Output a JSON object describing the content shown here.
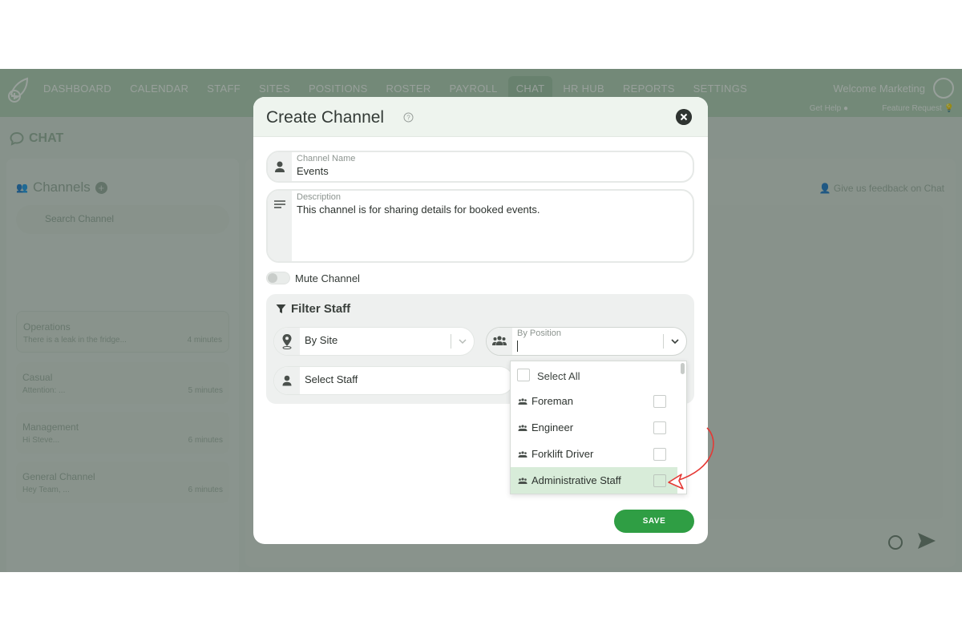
{
  "nav": {
    "items": [
      "DASHBOARD",
      "CALENDAR",
      "STAFF",
      "SITES",
      "POSITIONS",
      "ROSTER",
      "PAYROLL",
      "CHAT",
      "HR HUB",
      "REPORTS",
      "SETTINGS"
    ],
    "active": "CHAT",
    "welcome": "Welcome Marketing",
    "get_help": "Get Help",
    "feature_request": "Feature Request"
  },
  "page": {
    "title": "CHAT"
  },
  "sidebar": {
    "title": "Channels",
    "search_placeholder": "Search Channel",
    "channels": [
      {
        "name": "Operations",
        "message": "There is a leak in the fridge...",
        "time": "4 minutes"
      },
      {
        "name": "Casual",
        "message": "Attention: ...",
        "time": "5 minutes"
      },
      {
        "name": "Management",
        "message": "Hi Steve...",
        "time": "6 minutes"
      },
      {
        "name": "General Channel",
        "message": "Hey Team, ...",
        "time": "6 minutes"
      }
    ]
  },
  "main": {
    "feedback": "Give us feedback on Chat"
  },
  "modal": {
    "title": "Create Channel",
    "channel_name_label": "Channel Name",
    "channel_name_value": "Events",
    "description_label": "Description",
    "description_value": "This channel is for sharing details for booked events.",
    "mute_label": "Mute Channel",
    "filter_title": "Filter Staff",
    "by_site": "By Site",
    "by_position_label": "By Position",
    "select_staff": "Select Staff",
    "save": "SAVE"
  },
  "dropdown": {
    "select_all": "Select All",
    "options": [
      "Foreman",
      "Engineer",
      "Forklift Driver",
      "Administrative Staff"
    ],
    "highlighted": "Administrative Staff"
  },
  "colors": {
    "accent": "#2f9e44",
    "highlight": "#d8ecd9",
    "annotation": "#e53935"
  }
}
